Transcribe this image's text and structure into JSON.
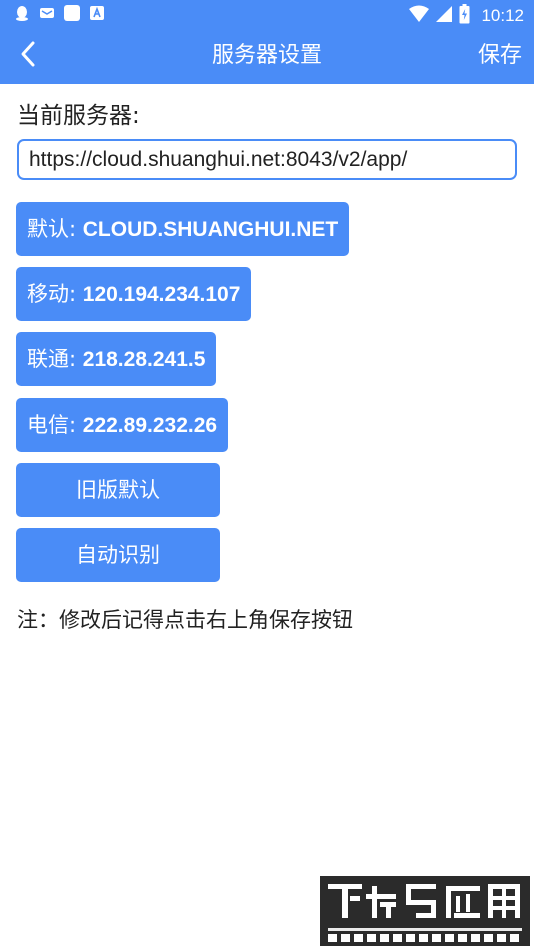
{
  "status_bar": {
    "time": "10:12",
    "left_icons": [
      "qq-icon",
      "mail-icon",
      "square-icon",
      "a-badge-icon"
    ],
    "right_icons": [
      "wifi-icon",
      "cell-signal-icon",
      "battery-icon"
    ]
  },
  "app_bar": {
    "back_icon": "chevron-left-icon",
    "title": "服务器设置",
    "save_label": "保存"
  },
  "current_server": {
    "label": "当前服务器:",
    "url_value": "https://cloud.shuanghui.net:8043/v2/app/"
  },
  "server_buttons": [
    {
      "prefix": "默认: ",
      "address": "CLOUD.SHUANGHUI.NET"
    },
    {
      "prefix": "移动: ",
      "address": "120.194.234.107"
    },
    {
      "prefix": "联通: ",
      "address": "218.28.241.5"
    },
    {
      "prefix": "电信: ",
      "address": "222.89.232.26"
    }
  ],
  "actions": {
    "legacy_default": "旧版默认",
    "auto_detect": "自动识别"
  },
  "note": "注：修改后记得点击右上角保存按钮",
  "colors": {
    "accent": "#4a8cf7",
    "text": "#222222",
    "background": "#ffffff"
  }
}
